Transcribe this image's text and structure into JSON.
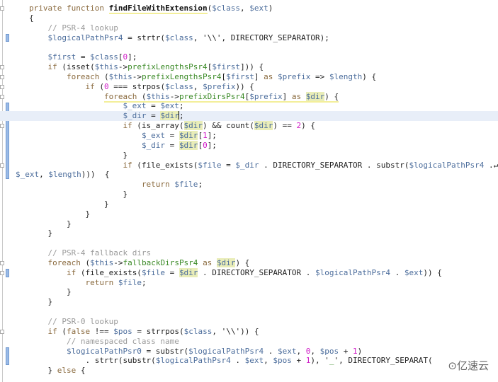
{
  "editor": {
    "current_line": 11,
    "accent_change_bar": "#9bbbe6",
    "lines": [
      {
        "i": 0,
        "t": [
          [
            "k",
            "private function "
          ],
          [
            "f u",
            "findFileWithExtension"
          ],
          [
            "t",
            "("
          ],
          [
            "v",
            "$class"
          ],
          [
            "t",
            ", "
          ],
          [
            "v",
            "$ext"
          ],
          [
            "t",
            ")"
          ]
        ]
      },
      {
        "i": 0,
        "t": [
          [
            "t",
            "{"
          ]
        ]
      },
      {
        "i": 1,
        "t": [
          [
            "c",
            "// PSR-4 lookup"
          ]
        ]
      },
      {
        "i": 1,
        "t": [
          [
            "v",
            "$logicalPathPsr4"
          ],
          [
            "t",
            " = strtr("
          ],
          [
            "v",
            "$class"
          ],
          [
            "t",
            ", '\\\\', DIRECTORY_SEPARATOR);"
          ]
        ]
      },
      {
        "i": 0,
        "t": []
      },
      {
        "i": 1,
        "t": [
          [
            "v",
            "$first"
          ],
          [
            "t",
            " = "
          ],
          [
            "v",
            "$class"
          ],
          [
            "t",
            "["
          ],
          [
            "n",
            "0"
          ],
          [
            "t",
            "];"
          ]
        ]
      },
      {
        "i": 1,
        "t": [
          [
            "k",
            "if"
          ],
          [
            "t",
            " (isset("
          ],
          [
            "v",
            "$this"
          ],
          [
            "t",
            "->"
          ],
          [
            "p",
            "prefixLengthsPsr4"
          ],
          [
            "t",
            "["
          ],
          [
            "v",
            "$first"
          ],
          [
            "t",
            "])) {"
          ]
        ]
      },
      {
        "i": 2,
        "t": [
          [
            "k",
            "foreach"
          ],
          [
            "t",
            " ("
          ],
          [
            "v",
            "$this"
          ],
          [
            "t",
            "->"
          ],
          [
            "p",
            "prefixLengthsPsr4"
          ],
          [
            "t",
            "["
          ],
          [
            "v",
            "$first"
          ],
          [
            "t",
            "] "
          ],
          [
            "k",
            "as"
          ],
          [
            "t",
            " "
          ],
          [
            "v",
            "$prefix"
          ],
          [
            "t",
            " => "
          ],
          [
            "v",
            "$length"
          ],
          [
            "t",
            ") {"
          ]
        ]
      },
      {
        "i": 3,
        "t": [
          [
            "k",
            "if"
          ],
          [
            "t",
            " ("
          ],
          [
            "n",
            "0"
          ],
          [
            "t",
            " === strpos("
          ],
          [
            "v",
            "$class"
          ],
          [
            "t",
            ", "
          ],
          [
            "v",
            "$prefix"
          ],
          [
            "t",
            ")) {"
          ]
        ]
      },
      {
        "i": 4,
        "u": true,
        "t": [
          [
            "k",
            "foreach"
          ],
          [
            "t",
            " ("
          ],
          [
            "v",
            "$this"
          ],
          [
            "t",
            "->"
          ],
          [
            "p",
            "prefixDirsPsr4"
          ],
          [
            "t",
            "["
          ],
          [
            "v",
            "$prefix"
          ],
          [
            "t",
            "] "
          ],
          [
            "k",
            "as"
          ],
          [
            "t",
            " "
          ],
          [
            "v h",
            "$dir"
          ],
          [
            "t",
            ") {"
          ]
        ]
      },
      {
        "i": 5,
        "t": [
          [
            "v",
            "$_ext"
          ],
          [
            "t",
            " = "
          ],
          [
            "v",
            "$ext"
          ],
          [
            "t",
            ";"
          ]
        ]
      },
      {
        "i": 5,
        "caret": true,
        "t": [
          [
            "v",
            "$_dir"
          ],
          [
            "t",
            " = "
          ],
          [
            "v h",
            "$dir"
          ],
          [
            "t",
            ";"
          ]
        ]
      },
      {
        "i": 5,
        "t": [
          [
            "k",
            "if"
          ],
          [
            "t",
            " (is_array("
          ],
          [
            "v h",
            "$dir"
          ],
          [
            "t",
            ") && count("
          ],
          [
            "v h",
            "$dir"
          ],
          [
            "t",
            ") == "
          ],
          [
            "n",
            "2"
          ],
          [
            "t",
            ") {"
          ]
        ]
      },
      {
        "i": 6,
        "t": [
          [
            "v",
            "$_ext"
          ],
          [
            "t",
            " = "
          ],
          [
            "v h",
            "$dir"
          ],
          [
            "t",
            "["
          ],
          [
            "n",
            "1"
          ],
          [
            "t",
            "];"
          ]
        ]
      },
      {
        "i": 6,
        "t": [
          [
            "v",
            "$_dir"
          ],
          [
            "t",
            " = "
          ],
          [
            "v h",
            "$dir"
          ],
          [
            "t",
            "["
          ],
          [
            "n",
            "0"
          ],
          [
            "t",
            "];"
          ]
        ]
      },
      {
        "i": 5,
        "t": [
          [
            "t",
            "}"
          ]
        ]
      },
      {
        "i": 5,
        "t": [
          [
            "k",
            "if"
          ],
          [
            "t",
            " (file_exists("
          ],
          [
            "v",
            "$file"
          ],
          [
            "t",
            " = "
          ],
          [
            "v",
            "$_dir"
          ],
          [
            "t",
            " . DIRECTORY_SEPARATOR . substr("
          ],
          [
            "v",
            "$logicalPathPsr4"
          ],
          [
            "t",
            " .↵"
          ]
        ]
      },
      {
        "i": 0,
        "wrap": true,
        "t": [
          [
            "v",
            "$_ext"
          ],
          [
            "t",
            ", "
          ],
          [
            "v",
            "$length"
          ],
          [
            "t",
            ")))  {"
          ]
        ]
      },
      {
        "i": 6,
        "t": [
          [
            "k",
            "return"
          ],
          [
            "t",
            " "
          ],
          [
            "v",
            "$file"
          ],
          [
            "t",
            ";"
          ]
        ]
      },
      {
        "i": 5,
        "t": [
          [
            "t",
            "}"
          ]
        ]
      },
      {
        "i": 4,
        "t": [
          [
            "t",
            "}"
          ]
        ]
      },
      {
        "i": 3,
        "t": [
          [
            "t",
            "}"
          ]
        ]
      },
      {
        "i": 2,
        "t": [
          [
            "t",
            "}"
          ]
        ]
      },
      {
        "i": 1,
        "t": [
          [
            "t",
            "}"
          ]
        ]
      },
      {
        "i": 0,
        "t": []
      },
      {
        "i": 1,
        "t": [
          [
            "c",
            "// PSR-4 fallback dirs"
          ]
        ]
      },
      {
        "i": 1,
        "t": [
          [
            "k",
            "foreach"
          ],
          [
            "t",
            " ("
          ],
          [
            "v",
            "$this"
          ],
          [
            "t",
            "->"
          ],
          [
            "p",
            "fallbackDirsPsr4"
          ],
          [
            "t",
            " "
          ],
          [
            "k",
            "as"
          ],
          [
            "t",
            " "
          ],
          [
            "v h",
            "$dir"
          ],
          [
            "t",
            ") {"
          ]
        ]
      },
      {
        "i": 2,
        "t": [
          [
            "k",
            "if"
          ],
          [
            "t",
            " (file_exists("
          ],
          [
            "v",
            "$file"
          ],
          [
            "t",
            " = "
          ],
          [
            "v h",
            "$dir"
          ],
          [
            "t",
            " . DIRECTORY_SEPARATOR . "
          ],
          [
            "v",
            "$logicalPathPsr4"
          ],
          [
            "t",
            " . "
          ],
          [
            "v",
            "$ext"
          ],
          [
            "t",
            ")) {"
          ]
        ]
      },
      {
        "i": 3,
        "t": [
          [
            "k",
            "return"
          ],
          [
            "t",
            " "
          ],
          [
            "v",
            "$file"
          ],
          [
            "t",
            ";"
          ]
        ]
      },
      {
        "i": 2,
        "t": [
          [
            "t",
            "}"
          ]
        ]
      },
      {
        "i": 1,
        "t": [
          [
            "t",
            "}"
          ]
        ]
      },
      {
        "i": 0,
        "t": []
      },
      {
        "i": 1,
        "t": [
          [
            "c",
            "// PSR-0 lookup"
          ]
        ]
      },
      {
        "i": 1,
        "t": [
          [
            "k",
            "if"
          ],
          [
            "t",
            " ("
          ],
          [
            "k",
            "false"
          ],
          [
            "t",
            " !== "
          ],
          [
            "v",
            "$pos"
          ],
          [
            "t",
            " = strrpos("
          ],
          [
            "v",
            "$class"
          ],
          [
            "t",
            ", '\\\\')) {"
          ]
        ]
      },
      {
        "i": 2,
        "t": [
          [
            "c",
            "// namespaced class name"
          ]
        ]
      },
      {
        "i": 2,
        "t": [
          [
            "v",
            "$logicalPathPsr0"
          ],
          [
            "t",
            " = substr("
          ],
          [
            "v",
            "$logicalPathPsr4"
          ],
          [
            "t",
            " . "
          ],
          [
            "v",
            "$ext"
          ],
          [
            "t",
            ", "
          ],
          [
            "n",
            "0"
          ],
          [
            "t",
            ", "
          ],
          [
            "v",
            "$pos"
          ],
          [
            "t",
            " + "
          ],
          [
            "n",
            "1"
          ],
          [
            "t",
            ")"
          ]
        ]
      },
      {
        "i": 3,
        "t": [
          [
            "t",
            ". strtr(substr("
          ],
          [
            "v",
            "$logicalPathPsr4"
          ],
          [
            "t",
            " . "
          ],
          [
            "v",
            "$ext"
          ],
          [
            "t",
            ", "
          ],
          [
            "v",
            "$pos"
          ],
          [
            "t",
            " + "
          ],
          [
            "n",
            "1"
          ],
          [
            "t",
            "), '"
          ],
          [
            "p",
            "_"
          ],
          [
            "t",
            "', DIRECTORY_SEPARAT("
          ]
        ]
      },
      {
        "i": 1,
        "t": [
          [
            "t",
            "} "
          ],
          [
            "k",
            "else"
          ],
          [
            "t",
            " {"
          ]
        ]
      }
    ]
  },
  "watermark": "⊙亿速云"
}
